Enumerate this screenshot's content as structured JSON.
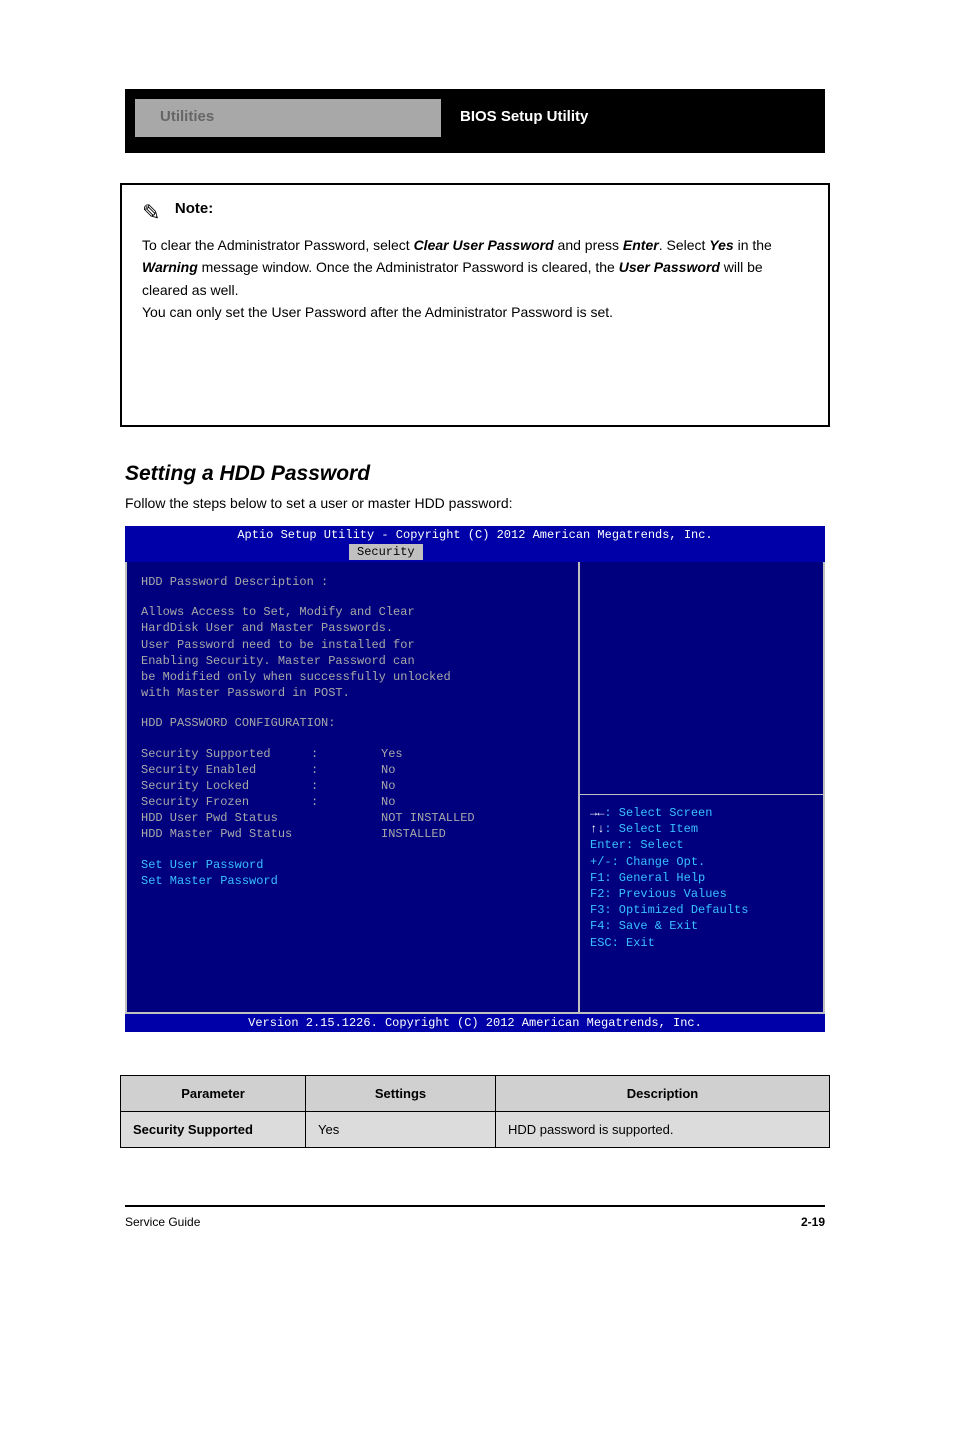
{
  "header": {
    "left": "Utilities",
    "right": "BIOS Setup Utility"
  },
  "note": {
    "title": "Note:",
    "body_parts": [
      "To clear the Administrator Password, select ",
      "Clear User Password",
      " and press ",
      "Enter",
      ". Select ",
      "Yes",
      " in the ",
      "Warning",
      " message window. Once the Administrator Password is cleared, the ",
      "User Password",
      " will be cleared as well.\nYou can only set the User Password after the Administrator Password is set."
    ]
  },
  "section": {
    "heading": "Setting a HDD Password",
    "intro": "Follow the steps below to set a user or master HDD password:"
  },
  "bios": {
    "top": "Aptio Setup Utility - Copyright (C) 2012 American Megatrends, Inc.",
    "tab": "Security",
    "left": {
      "desc_title": "HDD Password Description :",
      "desc_lines": [
        "Allows  Access to  Set, Modify  and  Clear",
        "HardDisk User and Master Passwords.",
        "User Password need to be installed for",
        "Enabling Security. Master Password can",
        "be Modified only when successfully unlocked",
        "with Master Password in POST."
      ],
      "config_title": "HDD PASSWORD CONFIGURATION:",
      "items": [
        {
          "label": "Security Supported",
          "colon": ":",
          "value": "Yes"
        },
        {
          "label": "Security Enabled",
          "colon": ":",
          "value": "No"
        },
        {
          "label": "Security Locked",
          "colon": ":",
          "value": "No"
        },
        {
          "label": "Security Frozen",
          "colon": ":",
          "value": "No"
        },
        {
          "label": "HDD User Pwd Status",
          "colon": "",
          "value": "NOT INSTALLED"
        },
        {
          "label": "HDD Master Pwd Status",
          "colon": "",
          "value": "INSTALLED"
        }
      ],
      "set_user": "Set User Password",
      "set_master": "Set Master Password"
    },
    "right": {
      "helps": [
        "→←: Select Screen",
        "↑↓: Select Item",
        "Enter: Select",
        "+/-: Change Opt.",
        "F1: General Help",
        "F2: Previous Values",
        "F3: Optimized Defaults",
        "F4: Save & Exit",
        "ESC: Exit"
      ]
    },
    "bottom": "Version 2.15.1226. Copyright (C) 2012 American Megatrends, Inc."
  },
  "table": {
    "h1": "Parameter",
    "h2": "Settings",
    "h3": "Description",
    "row_label": "Security Supported",
    "row_val": "Yes",
    "row_desc": "HDD password is supported."
  },
  "footer": {
    "left": "Service Guide",
    "right": "2-19"
  }
}
